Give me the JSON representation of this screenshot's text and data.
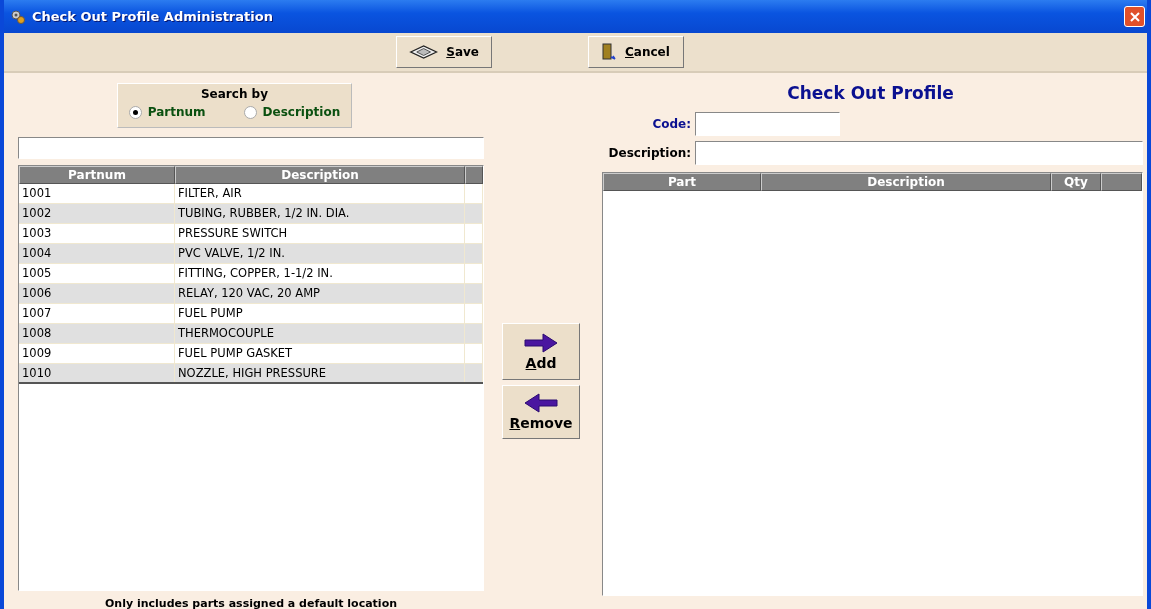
{
  "window": {
    "title": "Check Out Profile Administration"
  },
  "toolbar": {
    "buttons": [
      {
        "kind": "save",
        "label": "Save"
      },
      {
        "kind": "cancel",
        "label": "Cancel"
      }
    ]
  },
  "search": {
    "title": "Search by",
    "options": [
      {
        "label": "Partnum",
        "selected": true
      },
      {
        "label": "Description",
        "selected": false
      }
    ]
  },
  "parts_table": {
    "columns": [
      "Partnum",
      "Description"
    ],
    "rows": [
      {
        "partnum": "1001",
        "description": "FILTER, AIR"
      },
      {
        "partnum": "1002",
        "description": "TUBING, RUBBER, 1/2 IN. DIA."
      },
      {
        "partnum": "1003",
        "description": "PRESSURE SWITCH"
      },
      {
        "partnum": "1004",
        "description": "PVC VALVE, 1/2 IN."
      },
      {
        "partnum": "1005",
        "description": "FITTING, COPPER, 1-1/2 IN."
      },
      {
        "partnum": "1006",
        "description": "RELAY, 120 VAC, 20 AMP"
      },
      {
        "partnum": "1007",
        "description": "FUEL PUMP"
      },
      {
        "partnum": "1008",
        "description": "THERMOCOUPLE"
      },
      {
        "partnum": "1009",
        "description": "FUEL PUMP GASKET"
      },
      {
        "partnum": "1010",
        "description": "NOZZLE, HIGH PRESSURE"
      }
    ],
    "note": "Only includes parts assigned a default location"
  },
  "transfer_buttons": [
    {
      "kind": "add",
      "label": "Add"
    },
    {
      "kind": "remove",
      "label": "Remove"
    }
  ],
  "profile": {
    "title": "Check Out Profile",
    "fields": [
      {
        "kind": "code",
        "label": "Code:"
      },
      {
        "kind": "description",
        "label": "Description:"
      }
    ],
    "columns": [
      "Part",
      "Description",
      "Qty"
    ]
  }
}
